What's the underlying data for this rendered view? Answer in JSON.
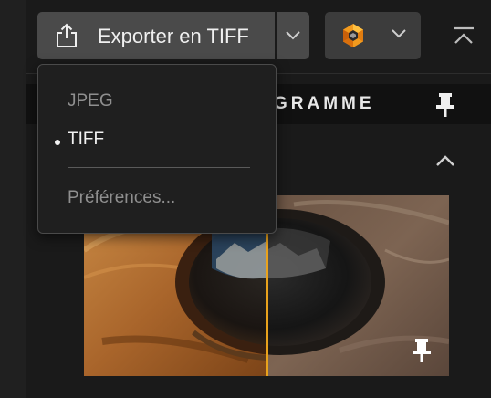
{
  "toolbar": {
    "export_label": "Exporter en TIFF",
    "icons": {
      "share": "share-icon",
      "chevron": "chevron-down-icon",
      "profile": "aperture-logo-icon",
      "collapse": "collapse-to-top-icon"
    }
  },
  "panel": {
    "title": "GRAMME",
    "icons": {
      "pin": "pin-icon",
      "collapse": "chevron-up-icon"
    }
  },
  "export_menu": {
    "items": [
      {
        "label": "JPEG",
        "state": "disabled"
      },
      {
        "label": "TIFF",
        "state": "selected"
      },
      {
        "label": "Préférences...",
        "state": "disabled"
      }
    ]
  },
  "colors": {
    "accent": "#e9a21c",
    "button_bg": "#4a4a4a",
    "background": "#1a1a1a",
    "panel_header_bg": "#111111"
  }
}
